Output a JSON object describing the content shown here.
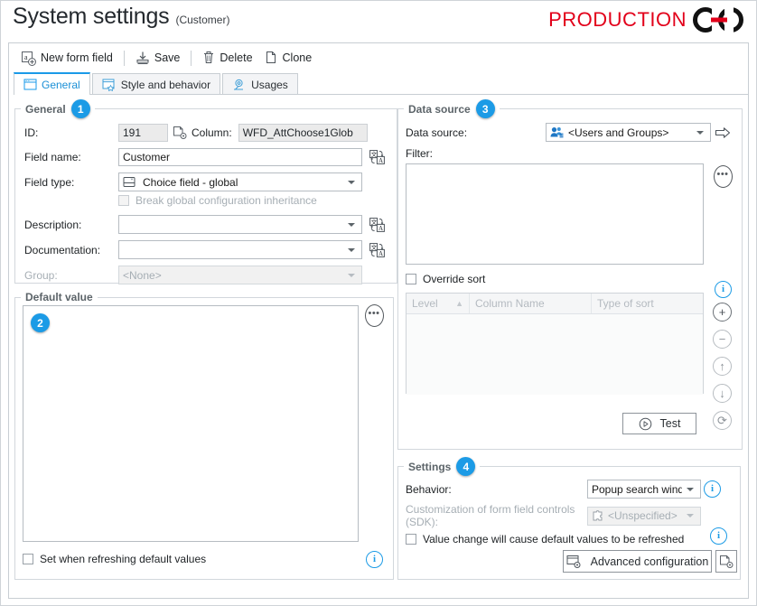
{
  "header": {
    "title": "System settings",
    "subtitle": "(Customer)",
    "logo_text": "PRODUCTION",
    "logo_color": "#e2001a"
  },
  "toolbar": {
    "new_form_field": "New form field",
    "save": "Save",
    "delete": "Delete",
    "clone": "Clone"
  },
  "tabs": [
    {
      "label": "General",
      "active": true
    },
    {
      "label": "Style and behavior",
      "active": false
    },
    {
      "label": "Usages",
      "active": false
    }
  ],
  "general": {
    "legend": "General",
    "badge": "1",
    "id_label": "ID:",
    "id_value": "191",
    "column_label": "Column:",
    "column_value": "WFD_AttChoose1Glob",
    "field_name_label": "Field name:",
    "field_name_value": "Customer",
    "field_type_label": "Field type:",
    "field_type_value": "Choice field - global",
    "break_inheritance_label": "Break global configuration inheritance",
    "description_label": "Description:",
    "description_value": "",
    "documentation_label": "Documentation:",
    "documentation_value": "",
    "group_label": "Group:",
    "group_value": "<None>"
  },
  "default_value": {
    "legend": "Default value",
    "badge": "2",
    "editor_value": "",
    "set_when_refreshing_label": "Set when refreshing default values"
  },
  "data_source": {
    "legend": "Data source",
    "badge": "3",
    "data_source_label": "Data source:",
    "data_source_value": "<Users and Groups>",
    "filter_label": "Filter:",
    "filter_value": "",
    "override_sort_label": "Override sort",
    "grid_columns": [
      "Level",
      "Column Name",
      "Type of sort"
    ],
    "grid_rows": [],
    "sort_indicator": "▲",
    "test_button": "Test"
  },
  "settings": {
    "legend": "Settings",
    "badge": "4",
    "behavior_label": "Behavior:",
    "behavior_value": "Popup search window",
    "sdk_label": "Customization of form field controls (SDK):",
    "sdk_value": "<Unspecified>",
    "value_change_label": "Value change will cause default values to be refreshed",
    "advanced_config_label": "Advanced configuration"
  },
  "colors": {
    "accent": "#1c9be6",
    "brand_red": "#e2001a",
    "tab_active_text": "#1a8fd6"
  }
}
